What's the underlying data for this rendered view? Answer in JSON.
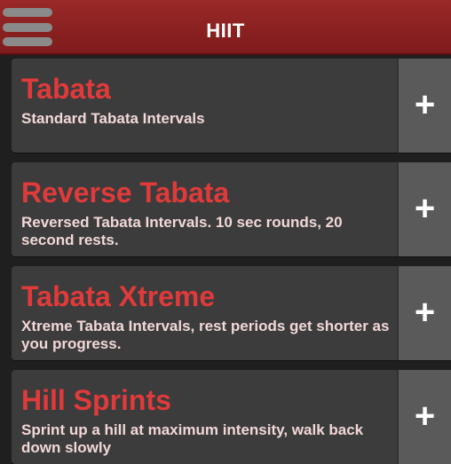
{
  "header": {
    "title": "HIIT"
  },
  "workouts": [
    {
      "name": "Tabata",
      "description": "Standard Tabata Intervals",
      "add_symbol": "+"
    },
    {
      "name": "Reverse Tabata",
      "description": "Reversed Tabata Intervals. 10 sec rounds, 20 second rests.",
      "add_symbol": "+"
    },
    {
      "name": "Tabata Xtreme",
      "description": "Xtreme Tabata Intervals, rest periods get shorter as you progress.",
      "add_symbol": "+"
    },
    {
      "name": "Hill Sprints",
      "description": "Sprint up a hill at maximum intensity, walk back down slowly",
      "add_symbol": "+"
    }
  ]
}
